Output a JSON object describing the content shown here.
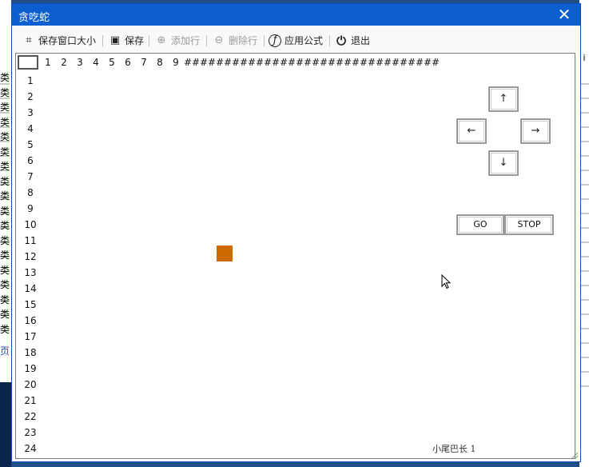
{
  "window": {
    "title": "贪吃蛇",
    "close_glyph": "✕"
  },
  "toolbar": {
    "items": [
      {
        "label": "保存窗口大小",
        "icon": "crop-icon",
        "glyph": "⌗",
        "enabled": true
      },
      {
        "label": "保存",
        "icon": "save-icon",
        "glyph": "▣",
        "enabled": true
      },
      {
        "label": "添加行",
        "icon": "add-circle-icon",
        "glyph": "⊕",
        "enabled": false
      },
      {
        "label": "删除行",
        "icon": "remove-circle-icon",
        "glyph": "⊖",
        "enabled": false
      },
      {
        "label": "应用公式",
        "icon": "function-icon",
        "glyph": "ƒ",
        "enabled": true
      },
      {
        "label": "退出",
        "icon": "power-icon",
        "glyph": "⏻",
        "enabled": true
      }
    ]
  },
  "grid": {
    "column_headers": [
      "1",
      "2",
      "3",
      "4",
      "5",
      "6",
      "7",
      "8",
      "9",
      "##",
      "##",
      "##",
      "##",
      "##",
      "##",
      "##",
      "##",
      "##",
      "##",
      "##",
      "##",
      "##",
      "##",
      "##",
      "##"
    ],
    "row_headers": [
      "1",
      "2",
      "3",
      "4",
      "5",
      "6",
      "7",
      "8",
      "9",
      "10",
      "11",
      "12",
      "13",
      "14",
      "15",
      "16",
      "17",
      "18",
      "19",
      "20",
      "21",
      "22",
      "23",
      "24"
    ],
    "snake_color": "#cc6a00"
  },
  "controls": {
    "up": "↑",
    "left": "←",
    "right": "→",
    "down": "↓",
    "go": "GO",
    "stop": "STOP"
  },
  "status": {
    "label": "小尾巴长 1"
  },
  "background": {
    "left_glyph": "类",
    "left_bottom_glyph": "页",
    "right_glyph": "i"
  }
}
